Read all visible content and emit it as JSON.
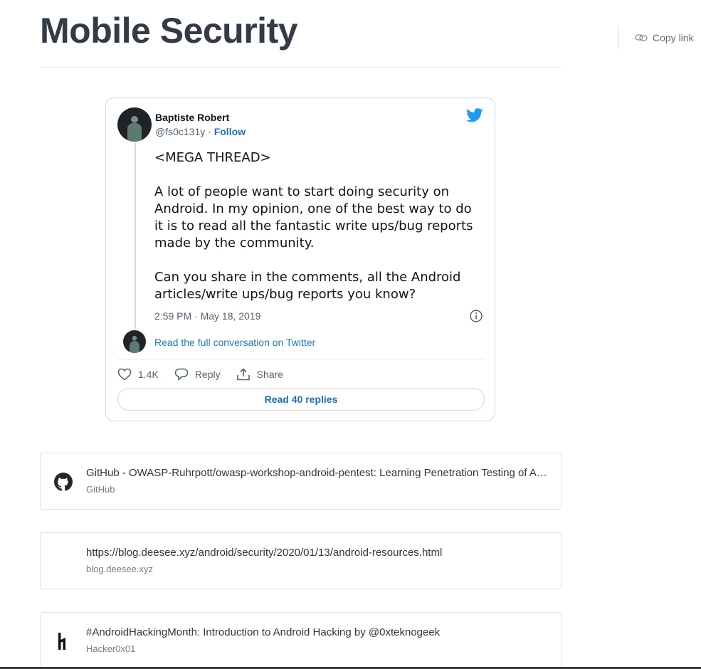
{
  "page": {
    "title": "Mobile Security",
    "copy_link": "Copy link",
    "copy_icon": "link-icon"
  },
  "tweet": {
    "author_name": "Baptiste Robert",
    "handle": "@fs0c131y",
    "separator": " · ",
    "follow": "Follow",
    "text": "<MEGA THREAD>\n\nA lot of people want to start doing security on Android. In my opinion, one of the best way to do it is to read all the fantastic write ups/bug reports made by the community.\n\nCan you share in the comments, all the Android articles/write ups/bug reports you know?",
    "timestamp": "2:59 PM · May 18, 2019",
    "read_full": "Read the full conversation on Twitter",
    "likes": "1.4K",
    "reply_label": "Reply",
    "share_label": "Share",
    "read_replies": "Read 40 replies",
    "brand_color": "#1d9bf0",
    "link_color": "#1d6fb5"
  },
  "bookmarks": [
    {
      "title": "GitHub - OWASP-Ruhrpott/owasp-workshop-android-pentest: Learning Penetration Testing of Android Applications",
      "source": "GitHub",
      "icon": "github-icon"
    },
    {
      "title": "https://blog.deesee.xyz/android/security/2020/01/13/android-resources.html",
      "source": "blog.deesee.xyz",
      "icon": ""
    },
    {
      "title": "#AndroidHackingMonth: Introduction to Android Hacking by @0xteknogeek",
      "source": "Hacker0x01",
      "icon": "hackerone-icon"
    }
  ]
}
